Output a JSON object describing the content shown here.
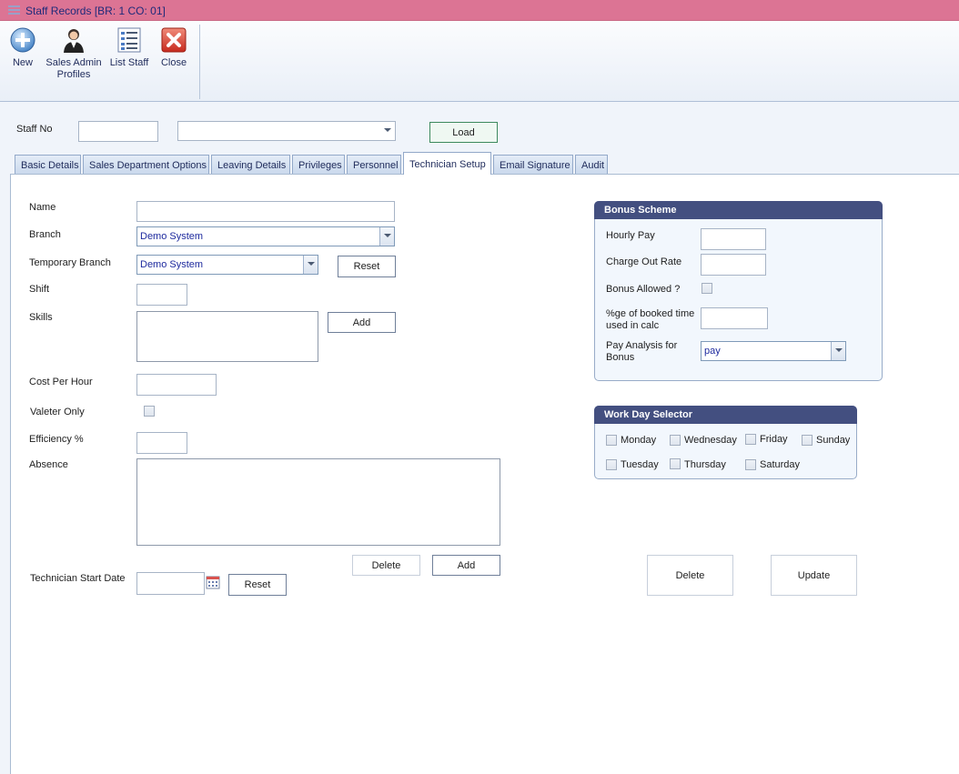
{
  "window": {
    "title": "Staff Records [BR: 1 CO: 01]"
  },
  "ribbon": {
    "new": "New",
    "sales_admin_1": "Sales Admin",
    "sales_admin_2": "Profiles",
    "list_staff": "List Staff",
    "close": "Close"
  },
  "header": {
    "staff_no_label": "Staff No",
    "staff_no_value": "",
    "staff_select_value": "",
    "load_label": "Load"
  },
  "tabs": [
    {
      "label": "Basic Details"
    },
    {
      "label": "Sales Department Options"
    },
    {
      "label": "Leaving Details"
    },
    {
      "label": "Privileges"
    },
    {
      "label": "Personnel"
    },
    {
      "label": "Technician Setup",
      "active": true
    },
    {
      "label": "Email Signature"
    },
    {
      "label": "Audit"
    }
  ],
  "form": {
    "name_label": "Name",
    "name_value": "",
    "branch_label": "Branch",
    "branch_value": "Demo System",
    "temp_branch_label": "Temporary Branch",
    "temp_branch_value": "Demo System",
    "reset_label": "Reset",
    "shift_label": "Shift",
    "skills_label": "Skills",
    "add_label": "Add",
    "cost_per_hour_label": "Cost Per Hour",
    "valeter_only_label": "Valeter Only",
    "efficiency_label": "Efficiency %",
    "absence_label": "Absence",
    "delete_label": "Delete",
    "absence_add_label": "Add",
    "tech_start_date_label": "Technician Start Date",
    "tech_reset_label": "Reset"
  },
  "bonus": {
    "title": "Bonus Scheme",
    "hourly_pay_label": "Hourly Pay",
    "charge_out_label": "Charge Out Rate",
    "bonus_allowed_label": "Bonus Allowed ?",
    "pct_label_1": "%ge of booked time",
    "pct_label_2": "used in calc",
    "pay_analysis_label_1": "Pay Analysis for",
    "pay_analysis_label_2": "Bonus",
    "pay_analysis_value": "pay"
  },
  "workday": {
    "title": "Work Day Selector",
    "days": [
      "Monday",
      "Wednesday",
      "Friday",
      "Sunday",
      "Tuesday",
      "Thursday",
      "Saturday"
    ]
  },
  "actions": {
    "delete": "Delete",
    "update": "Update"
  }
}
